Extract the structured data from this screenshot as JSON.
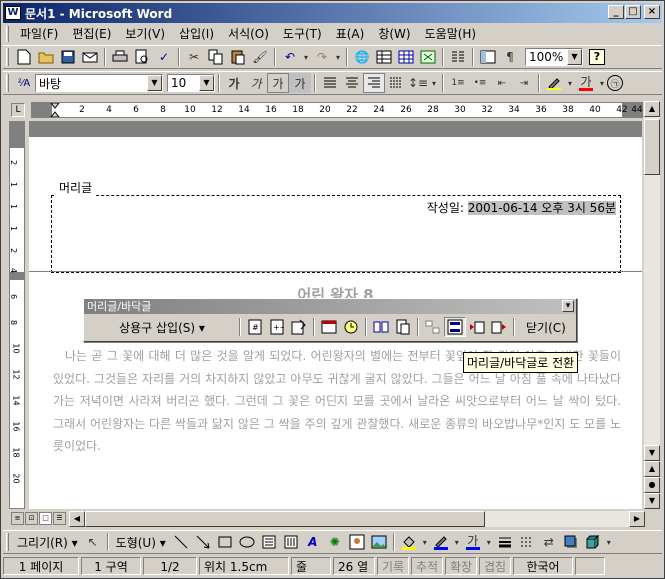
{
  "window": {
    "title": "문서1 - Microsoft Word",
    "icon": "word-doc-icon",
    "controls": {
      "minimize": "_",
      "maximize": "□",
      "close": "×"
    }
  },
  "menu": [
    "파일(F)",
    "편집(E)",
    "보기(V)",
    "삽입(I)",
    "서식(O)",
    "도구(T)",
    "표(A)",
    "창(W)",
    "도움말(H)"
  ],
  "toolbar_standard": {
    "zoom": "100%",
    "help": "?"
  },
  "toolbar_format": {
    "style": "바탕",
    "font_size": "10",
    "bold": "가",
    "italic": "가",
    "underline": "가",
    "charshade": "가",
    "font_color": "가"
  },
  "ruler": {
    "ticks": [
      "2",
      "4",
      "6",
      "8",
      "10",
      "12",
      "14",
      "16",
      "18",
      "20",
      "22",
      "24",
      "26",
      "28",
      "30",
      "32",
      "34",
      "36",
      "38",
      "40",
      "42",
      "44"
    ],
    "vticks": [
      "2",
      "1",
      "1",
      "1",
      "2",
      "4",
      "6",
      "8",
      "10",
      "12",
      "14",
      "16",
      "18",
      "20"
    ]
  },
  "document": {
    "header_label": "머리글",
    "header_date_prefix": "작성일:",
    "header_date_value": "2001-06-14 오후 3시 56분",
    "title": "어린 왕자 8",
    "body": "나는 곧 그 꽃에 대해 더 많은 것을 알게 되었다. 어린왕자의 별에는 전부터 꽃잎이 한 겹인 아주 소박한 꽃들이 있었다. 그것들은 자리를 거의 차지하지 않았고 아무도 귀찮게 굴지 않았다. 그들은 어느 날 아침 풀 속에 나타났다가는 저녁이면 사라져 버리곤 했다. 그런데 그 꽃은 어딘지 모를 곳에서 날라온 씨앗으로부터 어느 날 싹이 텄다. 그래서 어린왕자는 다른 싹들과 닮지 않은 그 싹을 주의 깊게 관찰했다. 새로운 종류의 바오밥나무*인지 도 모를 노릇이었다."
  },
  "header_footer_toolbar": {
    "title": "머리글/바닥글",
    "autotext": "상용구 삽입(S)",
    "close": "닫기(C)",
    "tooltip": "머리글/바닥글로 전환"
  },
  "drawing_toolbar": {
    "draw": "그리기(R)",
    "autoshapes": "도형(U)",
    "font_color": "가"
  },
  "status_bar": {
    "page": "1 페이지",
    "section": "1 구역",
    "pages": "1/2",
    "position": "위치 1.5cm",
    "line": "줄",
    "column": "26 열",
    "rec": "기록",
    "trk": "추적",
    "ext": "확장",
    "ovr": "겹침",
    "lang": "한국어"
  }
}
